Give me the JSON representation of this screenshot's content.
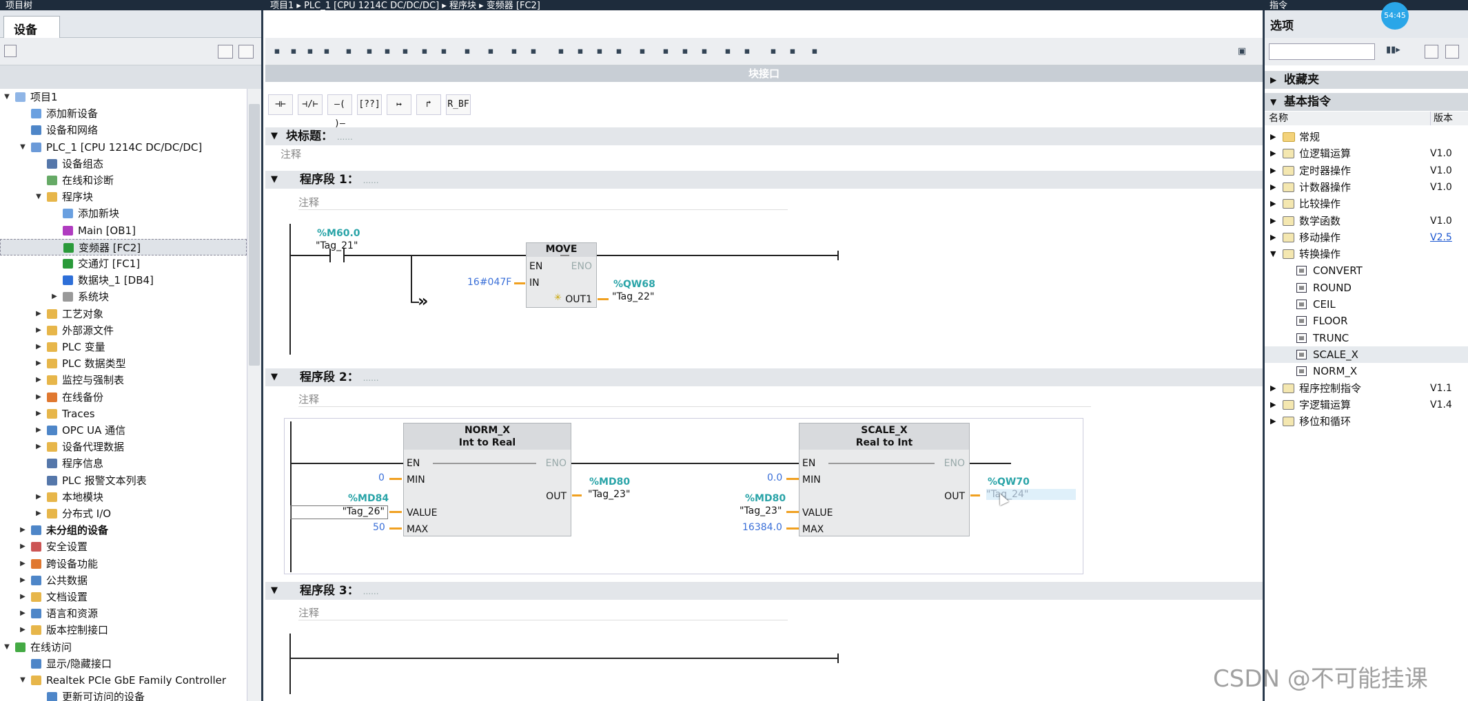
{
  "titlebar": {
    "left_title": "项目树",
    "editor_path": [
      "项目1",
      "PLC_1 [CPU 1214C DC/DC/DC]",
      "程序块",
      "变频器 [FC2]"
    ],
    "right_title": "指令"
  },
  "left_panel": {
    "tab": "设备",
    "tree": [
      {
        "label": "项目1",
        "level": 0,
        "arrow": "▼",
        "icon": "project-icon",
        "color": "#8fb5e6"
      },
      {
        "label": "添加新设备",
        "level": 1,
        "arrow": "",
        "icon": "add-device-icon",
        "color": "#6aa0e0"
      },
      {
        "label": "设备和网络",
        "level": 1,
        "arrow": "",
        "icon": "network-icon",
        "color": "#4e86c8"
      },
      {
        "label": "PLC_1 [CPU 1214C DC/DC/DC]",
        "level": 1,
        "arrow": "▼",
        "icon": "plc-icon",
        "color": "#6b9ad8"
      },
      {
        "label": "设备组态",
        "level": 2,
        "arrow": "",
        "icon": "device-config-icon",
        "color": "#5577aa"
      },
      {
        "label": "在线和诊断",
        "level": 2,
        "arrow": "",
        "icon": "diagnostics-icon",
        "color": "#66aa66"
      },
      {
        "label": "程序块",
        "level": 2,
        "arrow": "▼",
        "icon": "program-blocks-folder-icon",
        "color": "#e7b64a"
      },
      {
        "label": "添加新块",
        "level": 3,
        "arrow": "",
        "icon": "add-block-icon",
        "color": "#6aa0e0"
      },
      {
        "label": "Main [OB1]",
        "level": 3,
        "arrow": "",
        "icon": "ob-block-icon",
        "color": "#b03cc0"
      },
      {
        "label": "变频器 [FC2]",
        "level": 3,
        "arrow": "",
        "icon": "fc-block-icon",
        "color": "#2a9a3a",
        "selected": true
      },
      {
        "label": "交通灯 [FC1]",
        "level": 3,
        "arrow": "",
        "icon": "fc-block-icon",
        "color": "#2a9a3a"
      },
      {
        "label": "数据块_1 [DB4]",
        "level": 3,
        "arrow": "",
        "icon": "db-block-icon",
        "color": "#2e6fd8"
      },
      {
        "label": "系统块",
        "level": 3,
        "arrow": "▶",
        "icon": "system-block-icon",
        "color": "#999999"
      },
      {
        "label": "工艺对象",
        "level": 2,
        "arrow": "▶",
        "icon": "technology-object-icon",
        "color": "#e7b64a"
      },
      {
        "label": "外部源文件",
        "level": 2,
        "arrow": "▶",
        "icon": "external-source-icon",
        "color": "#e7b64a"
      },
      {
        "label": "PLC 变量",
        "level": 2,
        "arrow": "▶",
        "icon": "plc-tags-icon",
        "color": "#e7b64a"
      },
      {
        "label": "PLC 数据类型",
        "level": 2,
        "arrow": "▶",
        "icon": "plc-datatype-icon",
        "color": "#e7b64a"
      },
      {
        "label": "监控与强制表",
        "level": 2,
        "arrow": "▶",
        "icon": "watch-table-icon",
        "color": "#e7b64a"
      },
      {
        "label": "在线备份",
        "level": 2,
        "arrow": "▶",
        "icon": "online-backup-icon",
        "color": "#e07830"
      },
      {
        "label": "Traces",
        "level": 2,
        "arrow": "▶",
        "icon": "traces-icon",
        "color": "#e7b64a"
      },
      {
        "label": "OPC UA 通信",
        "level": 2,
        "arrow": "▶",
        "icon": "opcua-icon",
        "color": "#4e86c8"
      },
      {
        "label": "设备代理数据",
        "level": 2,
        "arrow": "▶",
        "icon": "device-proxy-icon",
        "color": "#e7b64a"
      },
      {
        "label": "程序信息",
        "level": 2,
        "arrow": "",
        "icon": "program-info-icon",
        "color": "#5577aa"
      },
      {
        "label": "PLC 报警文本列表",
        "level": 2,
        "arrow": "",
        "icon": "alarm-text-icon",
        "color": "#5577aa"
      },
      {
        "label": "本地模块",
        "level": 2,
        "arrow": "▶",
        "icon": "local-modules-icon",
        "color": "#e7b64a"
      },
      {
        "label": "分布式 I/O",
        "level": 2,
        "arrow": "▶",
        "icon": "distributed-io-icon",
        "color": "#e7b64a"
      },
      {
        "label": "未分组的设备",
        "level": 1,
        "arrow": "▶",
        "icon": "ungrouped-devices-icon",
        "color": "#4e86c8",
        "bold": true
      },
      {
        "label": "安全设置",
        "level": 1,
        "arrow": "▶",
        "icon": "security-icon",
        "color": "#cc5555"
      },
      {
        "label": "跨设备功能",
        "level": 1,
        "arrow": "▶",
        "icon": "cross-device-icon",
        "color": "#e07830"
      },
      {
        "label": "公共数据",
        "level": 1,
        "arrow": "▶",
        "icon": "common-data-icon",
        "color": "#4e86c8"
      },
      {
        "label": "文档设置",
        "level": 1,
        "arrow": "▶",
        "icon": "document-settings-icon",
        "color": "#e7b64a"
      },
      {
        "label": "语言和资源",
        "level": 1,
        "arrow": "▶",
        "icon": "languages-icon",
        "color": "#4e86c8"
      },
      {
        "label": "版本控制接口",
        "level": 1,
        "arrow": "▶",
        "icon": "version-control-icon",
        "color": "#e7b64a"
      },
      {
        "label": "在线访问",
        "level": 0,
        "arrow": "▼",
        "icon": "online-access-icon",
        "color": "#44aa44"
      },
      {
        "label": "显示/隐藏接口",
        "level": 1,
        "arrow": "",
        "icon": "show-hide-interface-icon",
        "color": "#4e86c8"
      },
      {
        "label": "Realtek PCIe GbE Family Controller",
        "level": 1,
        "arrow": "▼",
        "icon": "network-adapter-icon",
        "color": "#e7b64a"
      },
      {
        "label": "更新可访问的设备",
        "level": 2,
        "arrow": "",
        "icon": "update-devices-icon",
        "color": "#4e86c8"
      }
    ]
  },
  "editor": {
    "block_interface": "块接口",
    "ladder_buttons": [
      "⊣⊢",
      "⊣/⊢",
      "–( )–",
      "[??]",
      "↦",
      "↱",
      "R_BF"
    ],
    "block_title": "块标题：",
    "block_title_dots": "......",
    "comment": "注释",
    "networks": [
      {
        "title": "程序段 1：",
        "dots": "......",
        "comment": "注释",
        "contact": {
          "address": "%M60.0",
          "tag": "\"Tag_21\""
        },
        "box": {
          "name": "MOVE",
          "pins": [
            "EN",
            "ENO",
            "IN",
            "OUT1"
          ]
        },
        "in_const": "16#047F",
        "out": {
          "address": "%QW68",
          "tag": "\"Tag_22\""
        },
        "branch_arrow": "»"
      },
      {
        "title": "程序段 2：",
        "dots": "......",
        "comment": "注释",
        "norm": {
          "name": "NORM_X",
          "types": "Int  to  Real",
          "pins": [
            "EN",
            "ENO",
            "MIN",
            "OUT",
            "VALUE",
            "MAX"
          ],
          "min_const": "0",
          "max_const": "50",
          "value": {
            "address": "%MD84",
            "tag": "\"Tag_26\""
          },
          "out": {
            "address": "%MD80",
            "tag": "\"Tag_23\""
          }
        },
        "scale": {
          "name": "SCALE_X",
          "types": "Real  to  Int",
          "pins": [
            "EN",
            "ENO",
            "MIN",
            "OUT",
            "VALUE",
            "MAX"
          ],
          "min_const": "0.0",
          "max_const": "16384.0",
          "value": {
            "address": "%MD80",
            "tag": "\"Tag_23\""
          },
          "out": {
            "address": "%QW70",
            "tag": "\"Tag_24\""
          }
        }
      },
      {
        "title": "程序段 3：",
        "dots": "......",
        "comment": "注释"
      }
    ]
  },
  "right_panel": {
    "options": "选项",
    "favorites": "收藏夹",
    "basic": "基本指令",
    "col_name": "名称",
    "col_version": "版本",
    "items": [
      {
        "label": "常规",
        "version": "",
        "type": "folder",
        "arrow": "▶"
      },
      {
        "label": "位逻辑运算",
        "version": "V1.0",
        "type": "group",
        "arrow": "▶"
      },
      {
        "label": "定时器操作",
        "version": "V1.0",
        "type": "group",
        "arrow": "▶"
      },
      {
        "label": "计数器操作",
        "version": "V1.0",
        "type": "group",
        "arrow": "▶"
      },
      {
        "label": "比较操作",
        "version": "",
        "type": "group",
        "arrow": "▶"
      },
      {
        "label": "数学函数",
        "version": "V1.0",
        "type": "group",
        "arrow": "▶"
      },
      {
        "label": "移动操作",
        "version": "V2.5",
        "type": "group",
        "arrow": "▶",
        "link": true
      },
      {
        "label": "转换操作",
        "version": "",
        "type": "group",
        "arrow": "▼"
      },
      {
        "label": "CONVERT",
        "version": "",
        "type": "instr",
        "arrow": ""
      },
      {
        "label": "ROUND",
        "version": "",
        "type": "instr",
        "arrow": ""
      },
      {
        "label": "CEIL",
        "version": "",
        "type": "instr",
        "arrow": ""
      },
      {
        "label": "FLOOR",
        "version": "",
        "type": "instr",
        "arrow": ""
      },
      {
        "label": "TRUNC",
        "version": "",
        "type": "instr",
        "arrow": ""
      },
      {
        "label": "SCALE_X",
        "version": "",
        "type": "instr",
        "arrow": "",
        "hl": true
      },
      {
        "label": "NORM_X",
        "version": "",
        "type": "instr",
        "arrow": ""
      },
      {
        "label": "程序控制指令",
        "version": "V1.1",
        "type": "group",
        "arrow": "▶"
      },
      {
        "label": "字逻辑运算",
        "version": "V1.4",
        "type": "group",
        "arrow": "▶"
      },
      {
        "label": "移位和循环",
        "version": "",
        "type": "group",
        "arrow": "▶"
      }
    ]
  },
  "clock": "54:45",
  "watermark": "CSDN @不可能挂课"
}
